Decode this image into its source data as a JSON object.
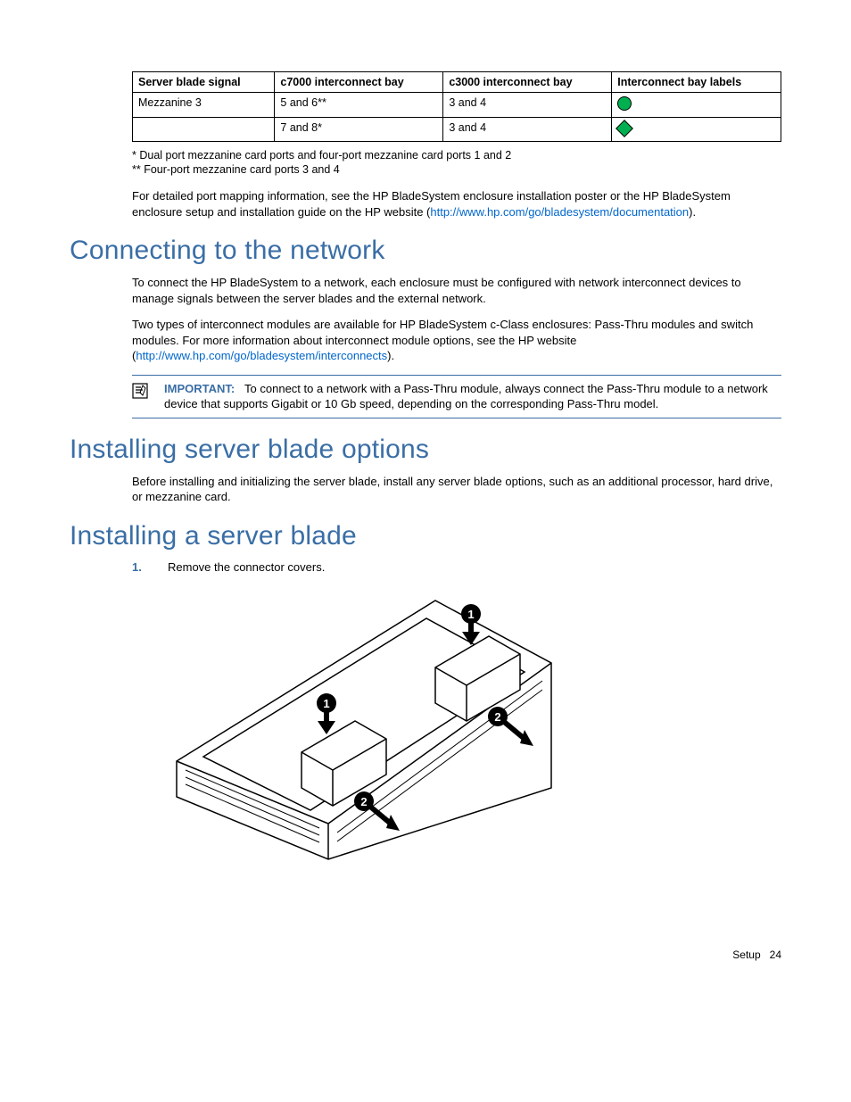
{
  "table": {
    "headers": [
      "Server blade signal",
      "c7000 interconnect bay",
      "c3000 interconnect bay",
      "Interconnect bay labels"
    ],
    "rows": [
      {
        "signal": "Mezzanine 3",
        "c7000": "5 and 6**",
        "c3000": "3 and 4",
        "icon": "circle"
      },
      {
        "signal": "",
        "c7000": "7 and 8*",
        "c3000": "3 and 4",
        "icon": "diamond"
      }
    ]
  },
  "footnotes": {
    "a": "* Dual port mezzanine card ports and four-port mezzanine card ports 1 and 2",
    "b": "** Four-port mezzanine card ports 3 and 4"
  },
  "para_mapping_a": "For detailed port mapping information, see the HP BladeSystem enclosure installation poster or the HP BladeSystem enclosure setup and installation guide on the HP website (",
  "para_mapping_link": "http://www.hp.com/go/bladesystem/documentation",
  "para_mapping_b": ").",
  "headings": {
    "connecting": "Connecting to the network",
    "options": "Installing server blade options",
    "installing": "Installing a server blade"
  },
  "connecting": {
    "p1": "To connect the HP BladeSystem to a network, each enclosure must be configured with network interconnect devices to manage signals between the server blades and the external network.",
    "p2a": "Two types of interconnect modules are available for HP BladeSystem c-Class enclosures: Pass-Thru modules and switch modules. For more information about interconnect module options, see the HP website (",
    "p2link": "http://www.hp.com/go/bladesystem/interconnects",
    "p2b": ")."
  },
  "important": {
    "label": "IMPORTANT:",
    "text": "To connect to a network with a Pass-Thru module, always connect the Pass-Thru module to a network device that supports Gigabit or 10 Gb speed, depending on the corresponding Pass-Thru model."
  },
  "options": {
    "p1": "Before installing and initializing the server blade, install any server blade options, such as an additional processor, hard drive, or mezzanine card."
  },
  "installing": {
    "step1_num": "1.",
    "step1_text": "Remove the connector covers."
  },
  "footer": {
    "section": "Setup",
    "page": "24"
  }
}
